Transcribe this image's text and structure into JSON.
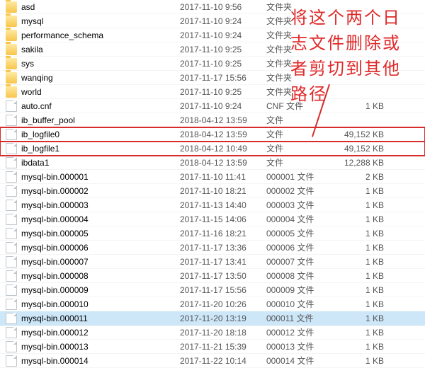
{
  "annotation_text": "将这个两个日志文件删除或者剪切到其他路径",
  "columns": {
    "date": "",
    "type": "",
    "size": ""
  },
  "rows": [
    {
      "icon": "folder",
      "name": "asd",
      "date": "2017-11-10 9:56",
      "type": "文件夹",
      "size": ""
    },
    {
      "icon": "folder",
      "name": "mysql",
      "date": "2017-11-10 9:24",
      "type": "文件夹",
      "size": ""
    },
    {
      "icon": "folder",
      "name": "performance_schema",
      "date": "2017-11-10 9:24",
      "type": "文件夹",
      "size": ""
    },
    {
      "icon": "folder",
      "name": "sakila",
      "date": "2017-11-10 9:25",
      "type": "文件夹",
      "size": ""
    },
    {
      "icon": "folder",
      "name": "sys",
      "date": "2017-11-10 9:25",
      "type": "文件夹",
      "size": ""
    },
    {
      "icon": "folder",
      "name": "wanqing",
      "date": "2017-11-17 15:56",
      "type": "文件夹",
      "size": ""
    },
    {
      "icon": "folder",
      "name": "world",
      "date": "2017-11-10 9:25",
      "type": "文件夹",
      "size": ""
    },
    {
      "icon": "file",
      "name": "auto.cnf",
      "date": "2017-11-10 9:24",
      "type": "CNF 文件",
      "size": "1 KB"
    },
    {
      "icon": "file",
      "name": "ib_buffer_pool",
      "date": "2018-04-12 13:59",
      "type": "文件",
      "size": ""
    },
    {
      "icon": "file",
      "name": "ib_logfile0",
      "date": "2018-04-12 13:59",
      "type": "文件",
      "size": "49,152 KB",
      "highlight": true
    },
    {
      "icon": "file",
      "name": "ib_logfile1",
      "date": "2018-04-12 10:49",
      "type": "文件",
      "size": "49,152 KB",
      "highlight": true
    },
    {
      "icon": "file",
      "name": "ibdata1",
      "date": "2018-04-12 13:59",
      "type": "文件",
      "size": "12,288 KB"
    },
    {
      "icon": "file",
      "name": "mysql-bin.000001",
      "date": "2017-11-10 11:41",
      "type": "000001 文件",
      "size": "2 KB"
    },
    {
      "icon": "file",
      "name": "mysql-bin.000002",
      "date": "2017-11-10 18:21",
      "type": "000002 文件",
      "size": "1 KB"
    },
    {
      "icon": "file",
      "name": "mysql-bin.000003",
      "date": "2017-11-13 14:40",
      "type": "000003 文件",
      "size": "1 KB"
    },
    {
      "icon": "file",
      "name": "mysql-bin.000004",
      "date": "2017-11-15 14:06",
      "type": "000004 文件",
      "size": "1 KB"
    },
    {
      "icon": "file",
      "name": "mysql-bin.000005",
      "date": "2017-11-16 18:21",
      "type": "000005 文件",
      "size": "1 KB"
    },
    {
      "icon": "file",
      "name": "mysql-bin.000006",
      "date": "2017-11-17 13:36",
      "type": "000006 文件",
      "size": "1 KB"
    },
    {
      "icon": "file",
      "name": "mysql-bin.000007",
      "date": "2017-11-17 13:41",
      "type": "000007 文件",
      "size": "1 KB"
    },
    {
      "icon": "file",
      "name": "mysql-bin.000008",
      "date": "2017-11-17 13:50",
      "type": "000008 文件",
      "size": "1 KB"
    },
    {
      "icon": "file",
      "name": "mysql-bin.000009",
      "date": "2017-11-17 15:56",
      "type": "000009 文件",
      "size": "1 KB"
    },
    {
      "icon": "file",
      "name": "mysql-bin.000010",
      "date": "2017-11-20 10:26",
      "type": "000010 文件",
      "size": "1 KB"
    },
    {
      "icon": "file",
      "name": "mysql-bin.000011",
      "date": "2017-11-20 13:19",
      "type": "000011 文件",
      "size": "1 KB",
      "selected": true
    },
    {
      "icon": "file",
      "name": "mysql-bin.000012",
      "date": "2017-11-20 18:18",
      "type": "000012 文件",
      "size": "1 KB"
    },
    {
      "icon": "file",
      "name": "mysql-bin.000013",
      "date": "2017-11-21 15:39",
      "type": "000013 文件",
      "size": "1 KB"
    },
    {
      "icon": "file",
      "name": "mysql-bin.000014",
      "date": "2017-11-22 10:14",
      "type": "000014 文件",
      "size": "1 KB"
    }
  ]
}
